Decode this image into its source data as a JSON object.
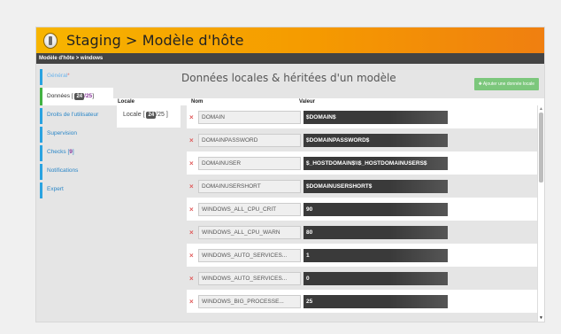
{
  "header": {
    "title": "Staging > Modèle d'hôte",
    "breadcrumb": "Modèle d'hôte > windows"
  },
  "sidebar": {
    "items": [
      {
        "label": "Général",
        "marker": "*"
      },
      {
        "label": "Données [",
        "badge": "24",
        "count": "/25",
        "suffix": "]"
      },
      {
        "label": "Droits de l'utilisateur"
      },
      {
        "label": "Supervision"
      },
      {
        "label": "Checks [",
        "count": "9",
        "suffix": "]"
      },
      {
        "label": "Notifications"
      },
      {
        "label": "Expert"
      }
    ]
  },
  "main": {
    "heading": "Données locales & héritées d'un modèle",
    "add_button": "Ajouter une donnée locale",
    "columns": {
      "locale": "Locale",
      "nom": "Nom",
      "valeur": "Valeur"
    },
    "locale_tab": {
      "prefix": "Locale [",
      "badge": "24",
      "count": "/25 ]"
    },
    "rows": [
      {
        "name": "DOMAIN",
        "value": "$DOMAIN$"
      },
      {
        "name": "DOMAINPASSWORD",
        "value": "$DOMAINPASSWORD$"
      },
      {
        "name": "DOMAINUSER",
        "value": "$_HOSTDOMAIN$\\\\$_HOSTDOMAINUSERS$"
      },
      {
        "name": "DOMAINUSERSHORT",
        "value": "$DOMAINUSERSHORT$"
      },
      {
        "name": "WINDOWS_ALL_CPU_CRIT",
        "value": "90"
      },
      {
        "name": "WINDOWS_ALL_CPU_WARN",
        "value": "80"
      },
      {
        "name": "WINDOWS_AUTO_SERVICES...",
        "value": "1"
      },
      {
        "name": "WINDOWS_AUTO_SERVICES...",
        "value": "0"
      },
      {
        "name": "WINDOWS_BIG_PROCESSE...",
        "value": "25"
      }
    ]
  },
  "colors": {
    "accent": "#f59a00",
    "link": "#2a86c7",
    "active": "#43b243",
    "button": "#7cc77c"
  }
}
